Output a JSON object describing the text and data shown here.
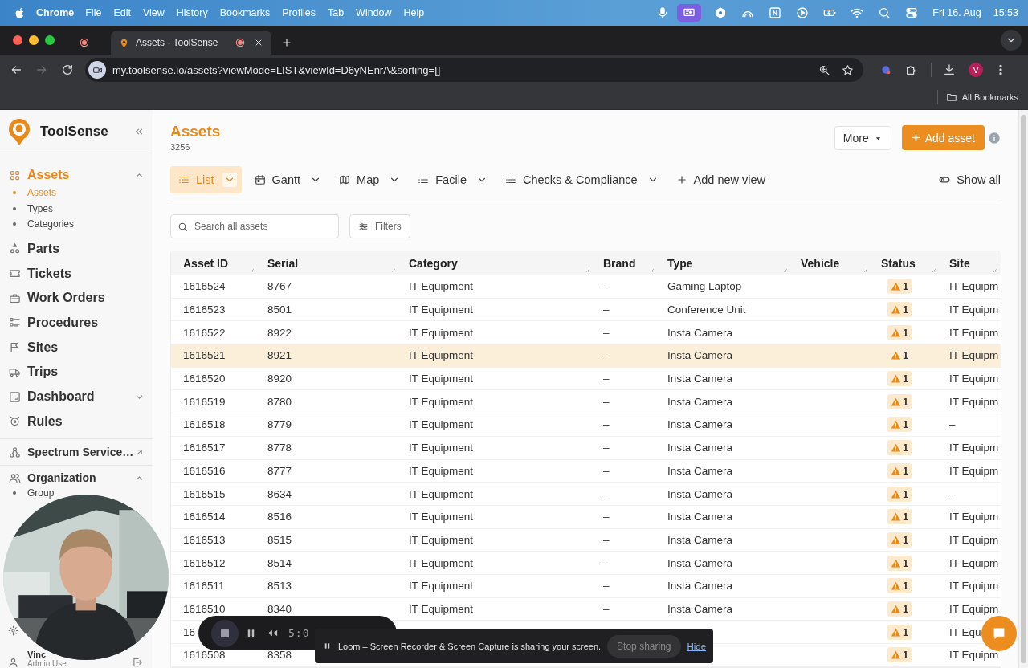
{
  "menu_bar": {
    "app": "Chrome",
    "menus": [
      "File",
      "Edit",
      "View",
      "History",
      "Bookmarks",
      "Profiles",
      "Tab",
      "Window",
      "Help"
    ],
    "date": "Fri 16. Aug",
    "time": "15:53"
  },
  "browser": {
    "tabs": [
      {
        "selected": false
      },
      {
        "title": "Assets - ToolSense",
        "selected": true
      }
    ],
    "nav_buttons": [
      {
        "disabled": false
      },
      {
        "disabled": true
      },
      {
        "disabled": false
      }
    ],
    "url": "my.toolsense.io/assets?viewMode=LIST&viewId=D6yNEnrA&sorting=[]",
    "profile_initial": "V",
    "bookmarks": "All Bookmarks"
  },
  "sidebar": {
    "brand": "ToolSense",
    "items": [
      {
        "label": "Assets",
        "selected": true,
        "expanded": true,
        "children": [
          {
            "label": "Assets",
            "selected": true
          },
          {
            "label": "Types",
            "selected": false
          },
          {
            "label": "Categories",
            "selected": false
          }
        ]
      },
      {
        "label": "Parts",
        "selected": false
      },
      {
        "label": "Tickets",
        "selected": false
      },
      {
        "label": "Work Orders",
        "selected": false
      },
      {
        "label": "Procedures",
        "selected": false
      },
      {
        "label": "Sites",
        "selected": false
      },
      {
        "label": "Trips",
        "selected": false
      },
      {
        "label": "Dashboard",
        "selected": false,
        "expanded": false
      },
      {
        "label": "Rules",
        "selected": false
      }
    ],
    "secondary": [
      {
        "label": "Spectrum Service…",
        "kind": "external",
        "selected": false
      },
      {
        "label": "Organization",
        "kind": "group",
        "selected": false,
        "expanded": true,
        "children": [
          {
            "label": "Group",
            "selected": false
          }
        ]
      }
    ],
    "user": {
      "name": "Vinc",
      "role": "Admin Use"
    }
  },
  "page": {
    "title": "Assets",
    "count": "3256",
    "more": "More",
    "add": "Add asset"
  },
  "views": [
    {
      "label": "List",
      "selected": true
    },
    {
      "label": "Gantt",
      "selected": false
    },
    {
      "label": "Map",
      "selected": false
    },
    {
      "label": "Facile",
      "selected": false
    },
    {
      "label": "Checks & Compliance",
      "selected": false
    }
  ],
  "add_view": "Add new view",
  "show_all": "Show all",
  "search": {
    "placeholder": "Search all assets"
  },
  "filters": "Filters",
  "table": {
    "columns": [
      "Asset ID",
      "Serial",
      "Category",
      "Brand",
      "Type",
      "Vehicle",
      "Status",
      "Site"
    ],
    "rows": [
      {
        "asset_id": "1616524",
        "serial": "8767",
        "category": "IT Equipment",
        "brand": "–",
        "type": "Gaming Laptop",
        "status": "1",
        "site": "IT Equipm",
        "highlighted": false
      },
      {
        "asset_id": "1616523",
        "serial": "8501",
        "category": "IT Equipment",
        "brand": "–",
        "type": "Conference Unit",
        "status": "1",
        "site": "IT Equipm",
        "highlighted": false
      },
      {
        "asset_id": "1616522",
        "serial": "8922",
        "category": "IT Equipment",
        "brand": "–",
        "type": "Insta Camera",
        "status": "1",
        "site": "IT Equipm",
        "highlighted": false
      },
      {
        "asset_id": "1616521",
        "serial": "8921",
        "category": "IT Equipment",
        "brand": "–",
        "type": "Insta Camera",
        "status": "1",
        "site": "IT Equipm",
        "highlighted": true
      },
      {
        "asset_id": "1616520",
        "serial": "8920",
        "category": "IT Equipment",
        "brand": "–",
        "type": "Insta Camera",
        "status": "1",
        "site": "IT Equipm",
        "highlighted": false
      },
      {
        "asset_id": "1616519",
        "serial": "8780",
        "category": "IT Equipment",
        "brand": "–",
        "type": "Insta Camera",
        "status": "1",
        "site": "IT Equipm",
        "highlighted": false
      },
      {
        "asset_id": "1616518",
        "serial": "8779",
        "category": "IT Equipment",
        "brand": "–",
        "type": "Insta Camera",
        "status": "1",
        "site": "–",
        "highlighted": false
      },
      {
        "asset_id": "1616517",
        "serial": "8778",
        "category": "IT Equipment",
        "brand": "–",
        "type": "Insta Camera",
        "status": "1",
        "site": "IT Equipm",
        "highlighted": false
      },
      {
        "asset_id": "1616516",
        "serial": "8777",
        "category": "IT Equipment",
        "brand": "–",
        "type": "Insta Camera",
        "status": "1",
        "site": "IT Equipm",
        "highlighted": false
      },
      {
        "asset_id": "1616515",
        "serial": "8634",
        "category": "IT Equipment",
        "brand": "–",
        "type": "Insta Camera",
        "status": "1",
        "site": "–",
        "highlighted": false
      },
      {
        "asset_id": "1616514",
        "serial": "8516",
        "category": "IT Equipment",
        "brand": "–",
        "type": "Insta Camera",
        "status": "1",
        "site": "IT Equipm",
        "highlighted": false
      },
      {
        "asset_id": "1616513",
        "serial": "8515",
        "category": "IT Equipment",
        "brand": "–",
        "type": "Insta Camera",
        "status": "1",
        "site": "IT Equipm",
        "highlighted": false
      },
      {
        "asset_id": "1616512",
        "serial": "8514",
        "category": "IT Equipment",
        "brand": "–",
        "type": "Insta Camera",
        "status": "1",
        "site": "IT Equipm",
        "highlighted": false
      },
      {
        "asset_id": "1616511",
        "serial": "8513",
        "category": "IT Equipment",
        "brand": "–",
        "type": "Insta Camera",
        "status": "1",
        "site": "IT Equipm",
        "highlighted": false
      },
      {
        "asset_id": "1616510",
        "serial": "8340",
        "category": "IT Equipment",
        "brand": "–",
        "type": "Insta Camera",
        "status": "1",
        "site": "IT Equipm",
        "highlighted": false
      },
      {
        "asset_id": "16",
        "status": "1",
        "site": "IT Equ",
        "highlighted": false
      },
      {
        "asset_id": "1616508",
        "serial": "8358",
        "status": "1",
        "site": "IT Equipm",
        "highlighted": false
      }
    ]
  },
  "recorder": {
    "time": "5:0"
  },
  "sharing_bar": {
    "message": "Loom – Screen Recorder & Screen Capture is sharing your screen.",
    "stop": "Stop sharing",
    "hide": "Hide"
  }
}
